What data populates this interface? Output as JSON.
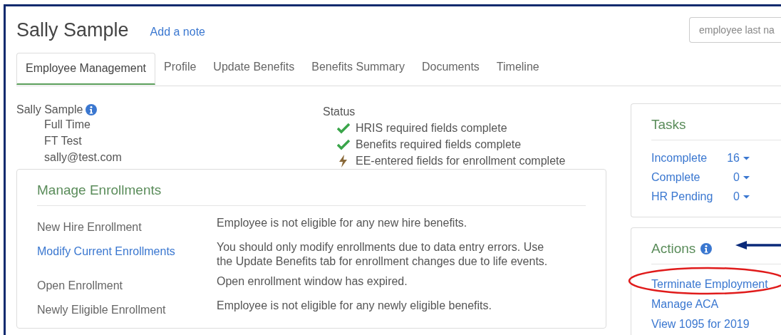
{
  "header": {
    "name": "Sally Sample",
    "note_link": "Add a note",
    "search": {
      "placeholder": "employee last na"
    }
  },
  "tabs": [
    {
      "label": "Employee Management",
      "selected": true
    },
    {
      "label": "Profile",
      "selected": false
    },
    {
      "label": "Update Benefits",
      "selected": false
    },
    {
      "label": "Benefits Summary",
      "selected": false
    },
    {
      "label": "Documents",
      "selected": false
    },
    {
      "label": "Timeline",
      "selected": false
    }
  ],
  "employee": {
    "name": "Sally Sample",
    "details": [
      "Full Time",
      "FT Test",
      "sally@test.com"
    ]
  },
  "status": {
    "title": "Status",
    "items": [
      {
        "kind": "check",
        "text": "HRIS required fields complete"
      },
      {
        "kind": "check",
        "text": "Benefits required fields complete"
      },
      {
        "kind": "pending",
        "text": "EE-entered fields for enrollment complete"
      }
    ]
  },
  "enrollments": {
    "title": "Manage Enrollments",
    "rows": [
      {
        "kind": "plain",
        "label": "New Hire Enrollment",
        "text": "Employee is not eligible for any new hire benefits."
      },
      {
        "kind": "link",
        "label": "Modify Current Enrollments",
        "text": "You should only modify enrollments due to data entry errors. Use the Update Benefits tab for enrollment changes due to life events."
      },
      {
        "kind": "plain",
        "label": "Open Enrollment",
        "text": "Open enrollment window has expired."
      },
      {
        "kind": "plain",
        "label": "Newly Eligible Enrollment",
        "text": "Employee is not eligible for any newly eligible benefits."
      }
    ]
  },
  "tasks": {
    "title": "Tasks",
    "items": [
      {
        "label": "Incomplete",
        "count": "16"
      },
      {
        "label": "Complete",
        "count": "0"
      },
      {
        "label": "HR Pending",
        "count": "0"
      }
    ]
  },
  "actions": {
    "title": "Actions",
    "links": [
      "Terminate Employment",
      "Manage ACA",
      "View 1095 for 2019"
    ]
  }
}
